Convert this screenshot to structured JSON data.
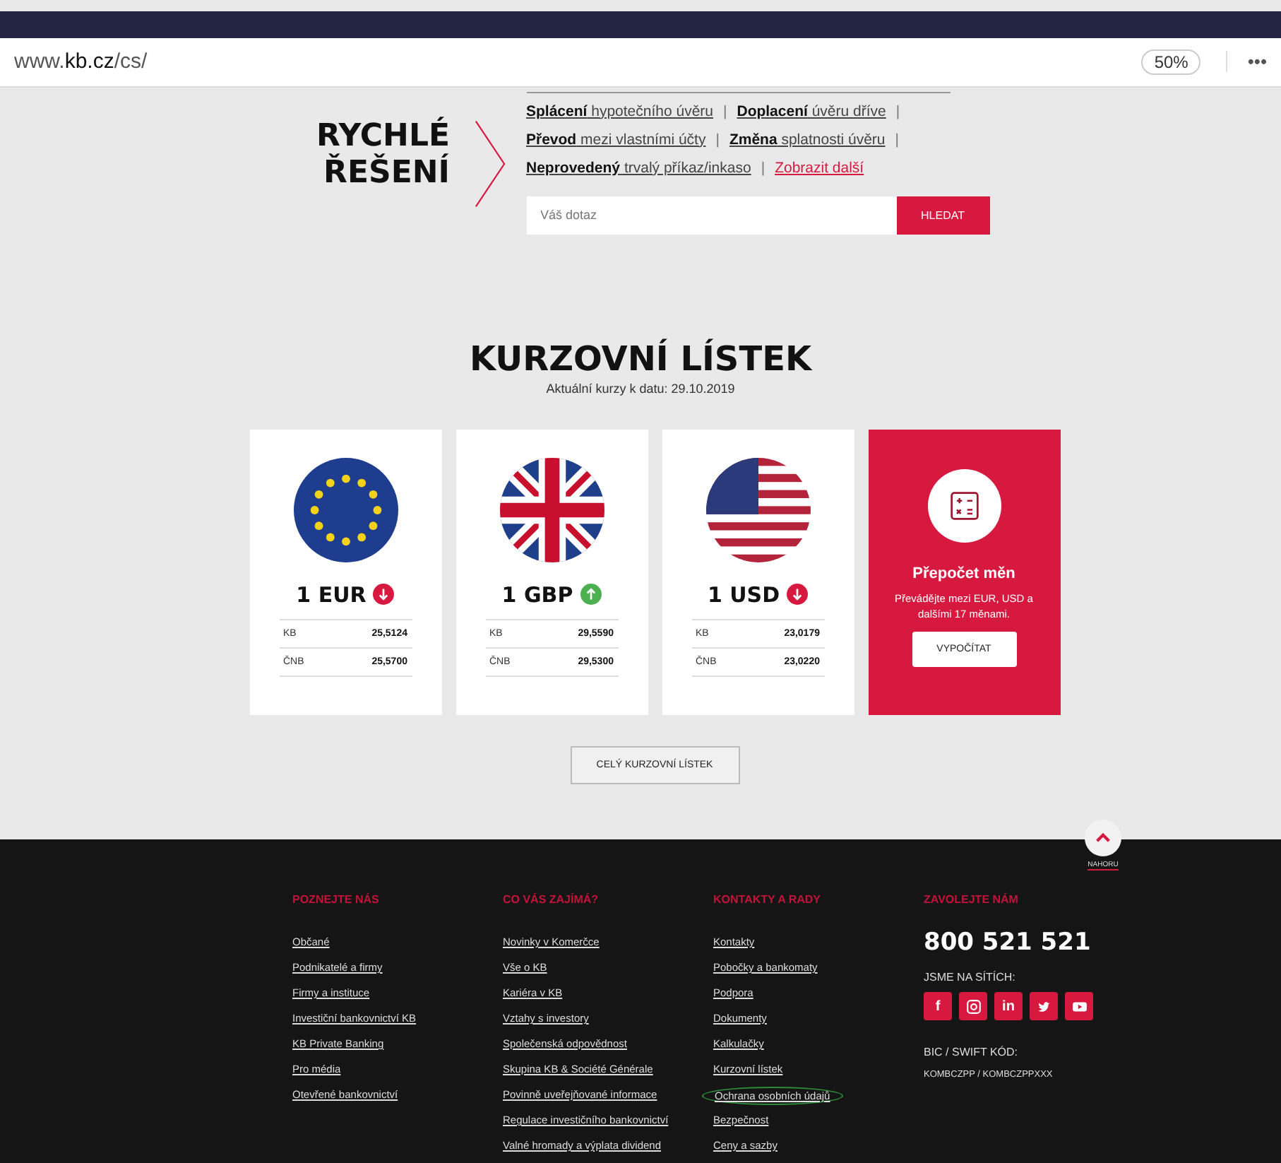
{
  "browser": {
    "url_prefix": "www.",
    "url_domain": "kb.cz",
    "url_path": "/cs/",
    "zoom": "50%",
    "menu": "•••"
  },
  "quick_help": {
    "title_lines": [
      "RYCHLÉ",
      "ŘEŠENÍ"
    ],
    "lines": [
      [
        {
          "bold": "Splácení",
          "rest": "hypotečního úvěru"
        },
        {
          "bold": "Doplacení",
          "rest": "úvěru dříve"
        }
      ],
      [
        {
          "bold": "Převod",
          "rest": "mezi vlastními účty"
        },
        {
          "bold": "Změna",
          "rest": "splatnosti úvěru"
        }
      ],
      [
        {
          "bold": "Neprovedený",
          "rest": "trvalý příkaz/inkaso"
        }
      ]
    ],
    "separator": "|",
    "more_link": "Zobrazit další",
    "search": {
      "placeholder": "Váš dotaz",
      "button": "HLEDAT"
    }
  },
  "rates": {
    "title": "KURZOVNÍ LÍSTEK",
    "subtitle": "Aktuální kurzy k datu: 29.10.2019",
    "cards": [
      {
        "kind": "eu",
        "label": "1 EUR",
        "rising": false,
        "rows": [
          {
            "name": "KB",
            "value": "25,5124"
          },
          {
            "name": "ČNB",
            "value": "25,5700"
          }
        ]
      },
      {
        "kind": "gb",
        "label": "1 GBP",
        "rising": true,
        "rows": [
          {
            "name": "KB",
            "value": "29,5590"
          },
          {
            "name": "ČNB",
            "value": "29,5300"
          }
        ]
      },
      {
        "kind": "us",
        "label": "1 USD",
        "rising": false,
        "rows": [
          {
            "name": "KB",
            "value": "23,0179"
          },
          {
            "name": "ČNB",
            "value": "23,0220"
          }
        ]
      }
    ],
    "converter": {
      "title": "Přepočet měn",
      "text": "Převádějte mezi EUR, USD a dalšími 17 měnami.",
      "button": "VYPOČÍTAT"
    },
    "all_button": "CELÝ KURZOVNÍ LÍSTEK"
  },
  "back_to_top": "NAHORU",
  "footer": {
    "columns": [
      {
        "title": "POZNEJTE NÁS",
        "links": [
          {
            "text": "Občané",
            "circled": false
          },
          {
            "text": "Podnikatelé a firmy",
            "circled": false
          },
          {
            "text": "Firmy a instituce",
            "circled": false
          },
          {
            "text": "Investiční bankovnictví KB",
            "circled": false
          },
          {
            "text": "KB Private Banking",
            "circled": false
          },
          {
            "text": "Pro média",
            "circled": false
          },
          {
            "text": "Otevřené bankovnictví",
            "circled": false
          }
        ]
      },
      {
        "title": "CO VÁS ZAJÍMÁ?",
        "links": [
          {
            "text": "Novinky v Komerčce",
            "circled": false
          },
          {
            "text": "Vše o KB",
            "circled": false
          },
          {
            "text": "Kariéra v KB",
            "circled": false
          },
          {
            "text": "Vztahy s investory",
            "circled": false
          },
          {
            "text": "Společenská odpovědnost",
            "circled": false
          },
          {
            "text": "Skupina KB & Société Générale",
            "circled": false
          },
          {
            "text": "Povinně uveřejňované informace",
            "circled": false
          },
          {
            "text": "Regulace investičního bankovnictví",
            "circled": false
          },
          {
            "text": "Valné hromady a výplata dividend",
            "circled": false
          }
        ]
      },
      {
        "title": "KONTAKTY A RADY",
        "links": [
          {
            "text": "Kontakty",
            "circled": false
          },
          {
            "text": "Pobočky a bankomaty",
            "circled": false
          },
          {
            "text": "Podpora",
            "circled": false
          },
          {
            "text": "Dokumenty",
            "circled": false
          },
          {
            "text": "Kalkulačky",
            "circled": false
          },
          {
            "text": "Kurzovní lístek",
            "circled": false
          },
          {
            "text": "Ochrana osobních údajů",
            "circled": true
          },
          {
            "text": "Bezpečnost",
            "circled": false
          },
          {
            "text": "Ceny a sazby",
            "circled": false
          }
        ]
      }
    ],
    "call": {
      "title": "ZAVOLEJTE NÁM",
      "phone": "800 521 521",
      "social_title": "JSME NA SÍTÍCH:",
      "social": [
        {
          "kind": "text",
          "label": "f"
        },
        {
          "kind": "instagram"
        },
        {
          "kind": "text",
          "label": "in"
        },
        {
          "kind": "twitter"
        },
        {
          "kind": "youtube"
        }
      ],
      "bic_title": "BIC / SWIFT KÓD:",
      "bic": "KOMBCZPP / KOMBCZPPXXX"
    }
  }
}
